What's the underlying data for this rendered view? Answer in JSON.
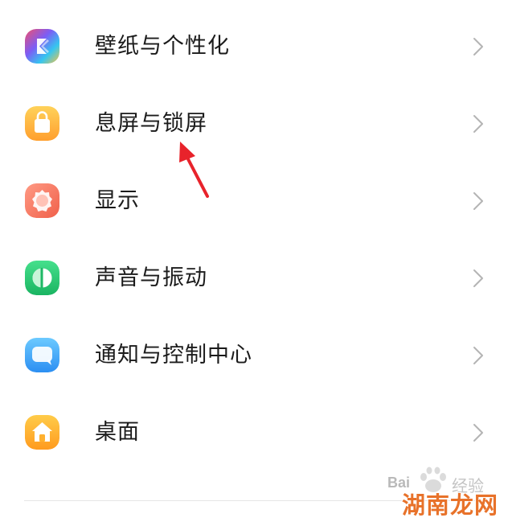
{
  "settings": {
    "items": [
      {
        "label": "壁纸与个性化",
        "icon": "wallpaper-personalization-icon",
        "colors": [
          "#f0506e",
          "#7c5cf5",
          "#35c6f0",
          "#f6c344"
        ]
      },
      {
        "label": "息屏与锁屏",
        "icon": "lock-screen-icon",
        "colors": [
          "#ffc84a",
          "#ff9f2e"
        ]
      },
      {
        "label": "显示",
        "icon": "display-icon",
        "colors": [
          "#ff8c78",
          "#f2674f"
        ]
      },
      {
        "label": "声音与振动",
        "icon": "sound-vibration-icon",
        "colors": [
          "#3ddc84",
          "#1fb866"
        ]
      },
      {
        "label": "通知与控制中心",
        "icon": "notification-control-center-icon",
        "colors": [
          "#62c3ff",
          "#2f95f4"
        ]
      },
      {
        "label": "桌面",
        "icon": "home-screen-icon",
        "colors": [
          "#ffc43d",
          "#ff9b1f"
        ]
      }
    ],
    "chevron_icon": "chevron-right-icon"
  },
  "annotation": {
    "arrow_color": "#e8232b"
  },
  "watermark": {
    "baidu": "Bai",
    "jingyan": "经验",
    "site": "湖南龙网"
  }
}
